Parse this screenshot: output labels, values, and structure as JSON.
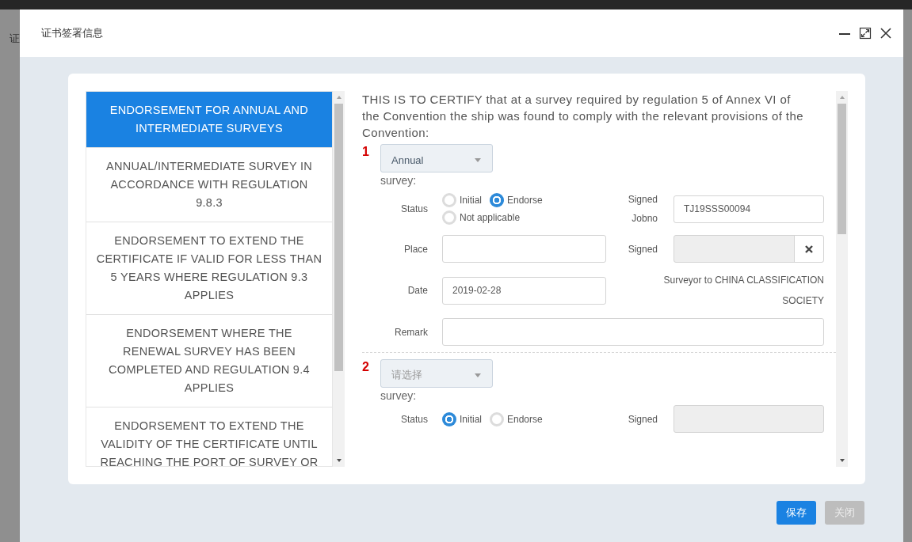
{
  "background": {
    "cut_text": "证"
  },
  "window": {
    "title": "证书签署信息"
  },
  "endorsement_list": [
    {
      "label": "ENDORSEMENT FOR ANNUAL AND INTERMEDIATE SURVEYS",
      "selected": true
    },
    {
      "label": "ANNUAL/INTERMEDIATE SURVEY IN ACCORDANCE WITH REGULATION 9.8.3",
      "selected": false
    },
    {
      "label": "ENDORSEMENT TO EXTEND THE CERTIFICATE IF VALID FOR LESS THAN 5 YEARS WHERE REGULATION 9.3 APPLIES",
      "selected": false
    },
    {
      "label": "ENDORSEMENT WHERE THE RENEWAL SURVEY HAS BEEN COMPLETED AND REGULATION 9.4 APPLIES",
      "selected": false
    },
    {
      "label": "ENDORSEMENT TO EXTEND THE VALIDITY OF THE CERTIFICATE UNTIL REACHING THE PORT OF SURVEY OR",
      "selected": false
    }
  ],
  "certify_text": "THIS IS TO CERTIFY that at a survey required by regulation 5 of Annex VI of the Convention the ship was found to comply with the relevant provisions of the Convention:",
  "surveys": [
    {
      "number": "1",
      "select": {
        "value": "Annual"
      },
      "survey_label": "survey:",
      "status": {
        "label": "Status",
        "options": [
          {
            "label": "Initial",
            "selected": false
          },
          {
            "label": "Endorse",
            "selected": true
          },
          {
            "label": "Not applicable",
            "selected": false
          }
        ]
      },
      "jobno": {
        "label": "Signed Jobno",
        "value": "TJ19SSS00094",
        "disabled": false
      },
      "place": {
        "label": "Place"
      },
      "signer": {
        "label": "Signed",
        "disabled": true
      },
      "date": {
        "label": "Date",
        "value": "2019-02-28"
      },
      "surveyor": "Surveyor to CHINA CLASSIFICATION SOCIETY",
      "remark": {
        "label": "Remark"
      }
    },
    {
      "number": "2",
      "select": {
        "placeholder": "请选择"
      },
      "survey_label": "survey:",
      "status": {
        "label": "Status",
        "options": [
          {
            "label": "Initial",
            "selected": true
          },
          {
            "label": "Endorse",
            "selected": false
          }
        ]
      },
      "jobno": {
        "label": "Signed",
        "disabled": true
      }
    }
  ],
  "buttons": [
    {
      "label": "保存",
      "disabled": false
    },
    {
      "label": "关闭",
      "disabled": true
    }
  ]
}
